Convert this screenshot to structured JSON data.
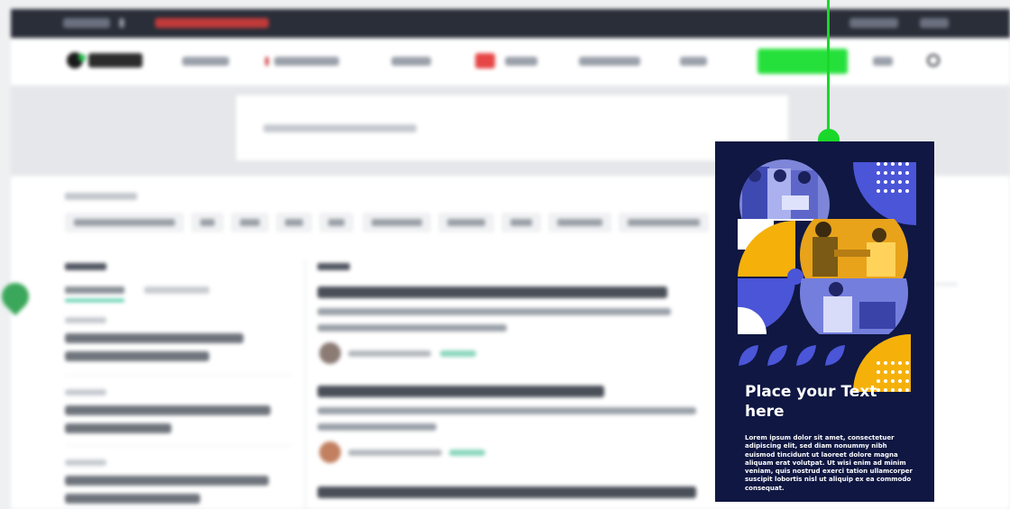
{
  "theme": {
    "topbar": "#2a2e38",
    "accent_green": "#19d829",
    "ad_background": "#0f1742",
    "ad_blue": "#4a55d8",
    "ad_yellow": "#f5b10a"
  },
  "background_site": {
    "note_blurred": true,
    "icons": [
      "logo-icon",
      "search-icon",
      "location-pin-icon"
    ]
  },
  "ad": {
    "title": "Place your Text here",
    "body": "Lorem ipsum dolor sit amet, consectetuer adipiscing elit, sed diam nonummy nibh euismod tincidunt ut laoreet dolore magna aliquam erat volutpat. Ut wisi enim ad minim veniam, quis nostrud exerci tation ullamcorper suscipit lobortis nisl ut aliquip ex ea commodo consequat."
  }
}
